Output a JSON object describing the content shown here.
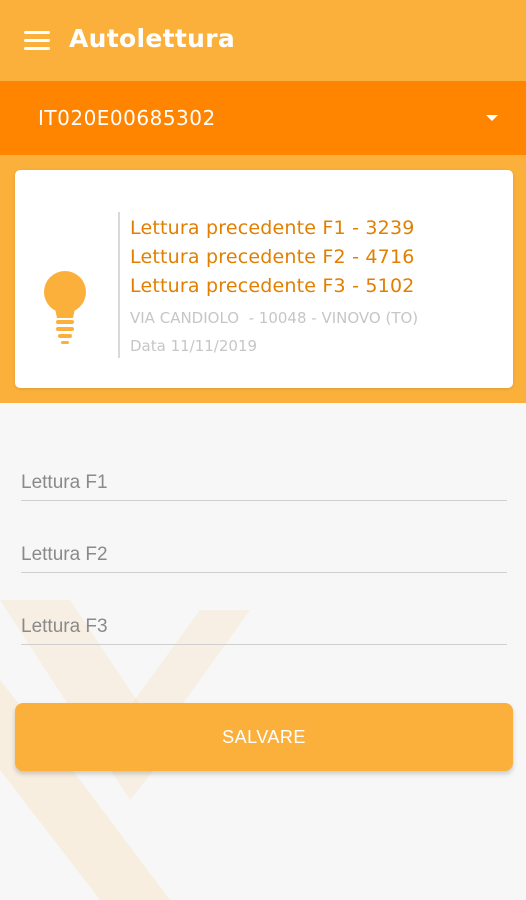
{
  "app_bar": {
    "title": "Autolettura",
    "menu_icon": "hamburger-menu-icon",
    "color": "#fbb03b"
  },
  "meter_selector": {
    "selected": "IT020E00685302",
    "caret_icon": "dropdown-caret-icon",
    "color": "#ff8400"
  },
  "info_card": {
    "icon": "lightbulb-icon",
    "readings": [
      "Lettura precedente F1 - 3239",
      "Lettura precedente F2 - 4716",
      "Lettura precedente F3 - 5102"
    ],
    "address": "VIA CANDIOLO  - 10048 - VINOVO (TO)",
    "date": "Data 11/11/2019",
    "reading_color": "#e27f00"
  },
  "form": {
    "f1_placeholder": "Lettura F1",
    "f2_placeholder": "Lettura F2",
    "f3_placeholder": "Lettura F3",
    "f1_value": "",
    "f2_value": "",
    "f3_value": ""
  },
  "save_button": {
    "label": "SALVARE"
  }
}
